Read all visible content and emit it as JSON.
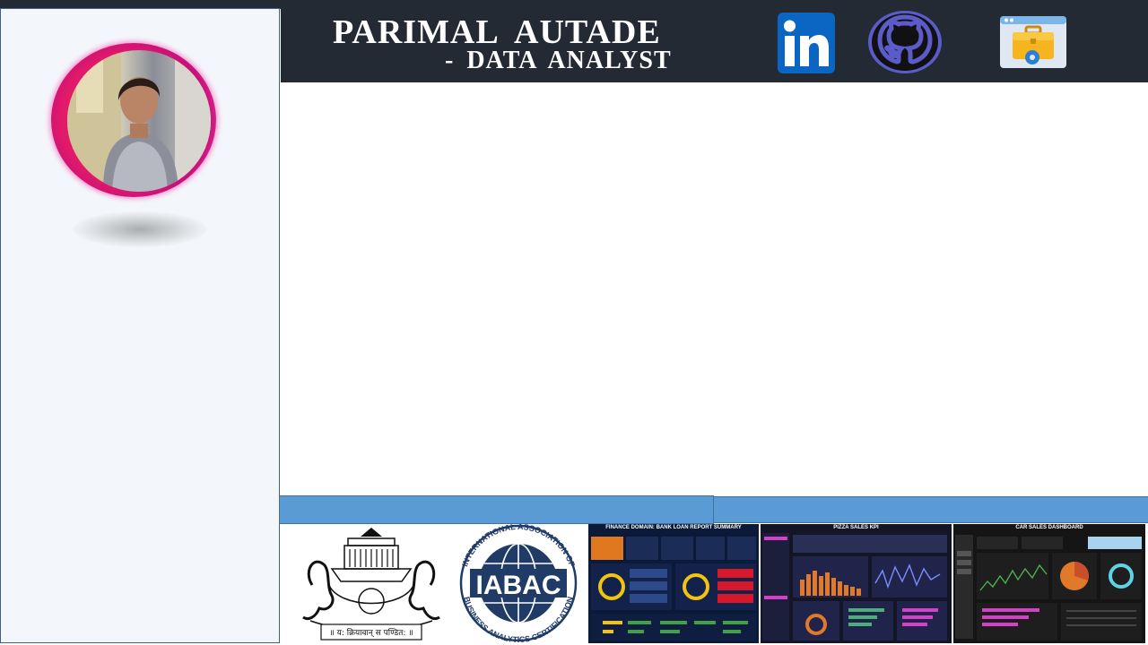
{
  "header": {
    "name": "PARIMAL  AUTADE",
    "role": "- DATA  ANALYST",
    "links": [
      {
        "label": "linkedin-icon"
      },
      {
        "label": "github-icon"
      },
      {
        "label": "portfolio-briefcase-icon"
      }
    ]
  },
  "logos": {
    "iabac_abbrev": "IABAC",
    "iabac_arc_top": "INTERNATIONAL ASSOCIATION OF",
    "iabac_arc_bottom": "BUSINESS ANALYTICS CERTIFICATION",
    "university_motto": "॥ य: क्रियावान् स पण्डित: ॥"
  },
  "projects": {
    "bank_dashboard_title": "FINANCE DOMAIN: BANK LOAN REPORT SUMMARY",
    "pizza_dashboard_title": "PIZZA SALES KPI",
    "car_dashboard_title": "CAR SALES DASHBOARD"
  },
  "colors": {
    "header_bg": "#232a33",
    "sidebar_bg": "#f3f7fb",
    "accent_band": "#5b9bd5",
    "linkedin": "#0a66c2",
    "github_ring": "#5b5cc9",
    "avatar_ring": "#e0196a"
  }
}
